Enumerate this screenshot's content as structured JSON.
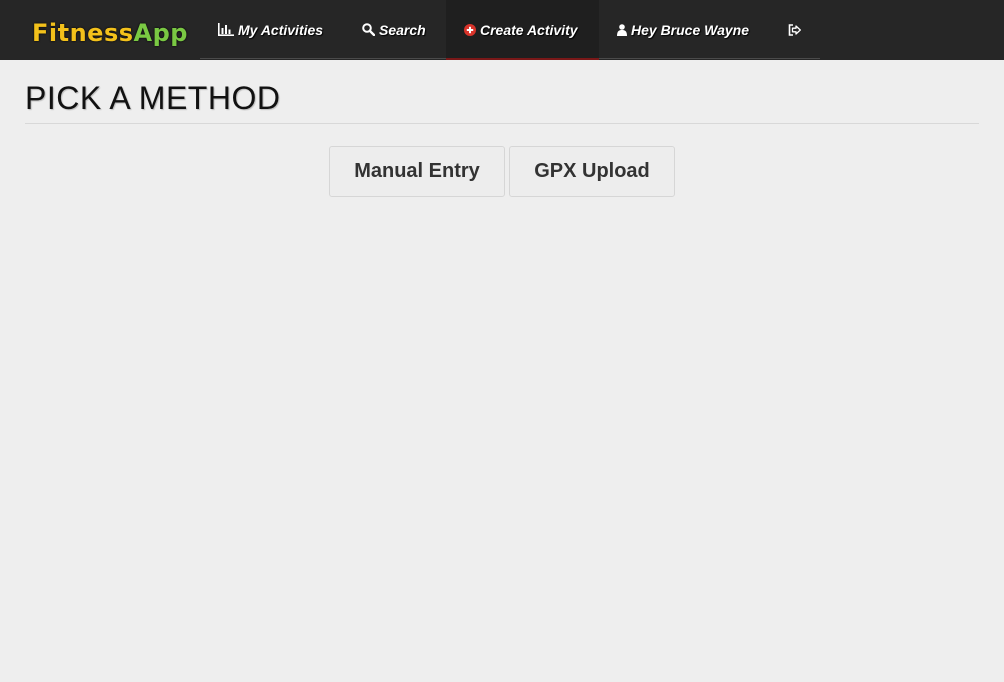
{
  "brand": {
    "part1": "Fitness",
    "part2": "App"
  },
  "nav": {
    "my_activities": {
      "icon": "bar-chart-icon",
      "label": "My Activities"
    },
    "search": {
      "icon": "search-icon",
      "label": "Search"
    },
    "create_activity": {
      "icon": "plus-circle-icon",
      "label": "Create Activity"
    },
    "user": {
      "icon": "user-icon",
      "label": "Hey Bruce Wayne"
    },
    "logout": {
      "icon": "sign-out-icon"
    }
  },
  "page": {
    "title": "PICK A METHOD"
  },
  "methods": {
    "manual_entry": "Manual Entry",
    "gpx_upload": "GPX Upload"
  },
  "colors": {
    "navbar": "#262626",
    "brand_fitness": "#f3c11b",
    "brand_app": "#7ac943",
    "create_icon": "#d9342b",
    "active_underline": "#7a1818",
    "background": "#eeeeee"
  }
}
